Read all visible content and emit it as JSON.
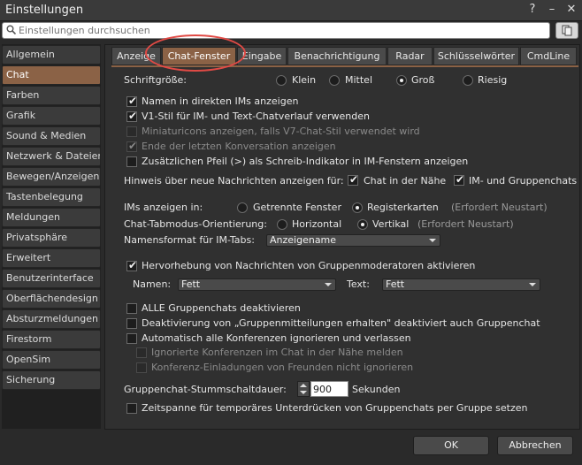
{
  "window": {
    "title": "Einstellungen",
    "help_glyph": "?",
    "minimize_glyph": "–",
    "close_glyph": "✕"
  },
  "search": {
    "placeholder": "Einstellungen durchsuchen"
  },
  "sidebar": {
    "items": [
      {
        "label": "Allgemein"
      },
      {
        "label": "Chat"
      },
      {
        "label": "Farben"
      },
      {
        "label": "Grafik"
      },
      {
        "label": "Sound & Medien"
      },
      {
        "label": "Netzwerk & Dateien"
      },
      {
        "label": "Bewegen/Anzeigen"
      },
      {
        "label": "Tastenbelegung"
      },
      {
        "label": "Meldungen"
      },
      {
        "label": "Privatsphäre"
      },
      {
        "label": "Erweitert"
      },
      {
        "label": "Benutzerinterface"
      },
      {
        "label": "Oberflächendesign"
      },
      {
        "label": "Absturzmeldungen"
      },
      {
        "label": "Firestorm"
      },
      {
        "label": "OpenSim"
      },
      {
        "label": "Sicherung"
      }
    ],
    "active_index": 1
  },
  "tabs": {
    "items": [
      {
        "label": "Anzeige"
      },
      {
        "label": "Chat-Fenster"
      },
      {
        "label": "Eingabe"
      },
      {
        "label": "Benachrichtigung"
      },
      {
        "label": "Radar"
      },
      {
        "label": "Schlüsselwörter"
      },
      {
        "label": "CmdLine"
      }
    ],
    "active_index": 1
  },
  "font_size": {
    "label": "Schriftgröße:",
    "options": [
      {
        "label": "Klein"
      },
      {
        "label": "Mittel"
      },
      {
        "label": "Groß"
      },
      {
        "label": "Riesig"
      }
    ],
    "selected": "Groß"
  },
  "opts": {
    "names_in_ims": {
      "label": "Namen in direkten IMs anzeigen",
      "checked": true
    },
    "v1_style": {
      "label": "V1-Stil für IM- und Text-Chatverlauf verwenden",
      "checked": true
    },
    "mini_icons": {
      "label": "Miniaturicons anzeigen, falls V7-Chat-Stil verwendet wird",
      "checked": false,
      "disabled": true
    },
    "end_conv": {
      "label": "Ende der letzten Konversation anzeigen",
      "checked": true,
      "disabled": true
    },
    "extra_arrow": {
      "label": "Zusätzlichen Pfeil (>) als Schreib-Indikator in IM-Fenstern anzeigen",
      "checked": false
    }
  },
  "new_msg": {
    "label": "Hinweis über neue Nachrichten anzeigen für:",
    "nearby": {
      "label": "Chat in der Nähe",
      "checked": true
    },
    "im_group": {
      "label": "IM- und Gruppenchats",
      "checked": true
    }
  },
  "ims_in": {
    "label": "IMs anzeigen in:",
    "separate": {
      "label": "Getrennte Fenster"
    },
    "tabs": {
      "label": "Registerkarten"
    },
    "selected": "Registerkarten",
    "note": "(Erfordert Neustart)"
  },
  "tab_orient": {
    "label": "Chat-Tabmodus-Orientierung:",
    "horizontal": {
      "label": "Horizontal"
    },
    "vertical": {
      "label": "Vertikal"
    },
    "selected": "Vertikal",
    "note": "(Erfordert Neustart)"
  },
  "name_format": {
    "label": "Namensformat für IM-Tabs:",
    "value": "Anzeigename"
  },
  "moderator": {
    "label": "Hervorhebung von Nachrichten von Gruppenmoderatoren aktivieren",
    "checked": true,
    "name_label": "Namen:",
    "name_value": "Fett",
    "text_label": "Text:",
    "text_value": "Fett"
  },
  "group_opts": {
    "disable_all": {
      "label": "ALLE Gruppenchats deaktivieren",
      "checked": false
    },
    "deactivate_notices": {
      "label": "Deaktivierung von „Gruppenmitteilungen erhalten\" deaktiviert auch Gruppenchat",
      "checked": false
    },
    "auto_ignore": {
      "label": "Automatisch alle Konferenzen ignorieren und verlassen",
      "checked": false
    },
    "ignore_nearby": {
      "label": "Ignorierte Konferenzen im Chat in der Nähe melden",
      "checked": false,
      "disabled": true
    },
    "friend_invites": {
      "label": "Konferenz-Einladungen von Freunden nicht ignorieren",
      "checked": false,
      "disabled": true
    }
  },
  "mute": {
    "label": "Gruppenchat-Stummschaltdauer:",
    "value": "900",
    "unit": "Sekunden"
  },
  "temp_suppress": {
    "label": "Zeitspanne für temporäres Unterdrücken von Gruppenchats per Gruppe setzen",
    "checked": false
  },
  "buttons": {
    "ok": "OK",
    "cancel": "Abbrechen"
  },
  "colors": {
    "accent": "#8b6246",
    "highlight_ring": "#e04a45",
    "bg": "#2a2a2a"
  }
}
